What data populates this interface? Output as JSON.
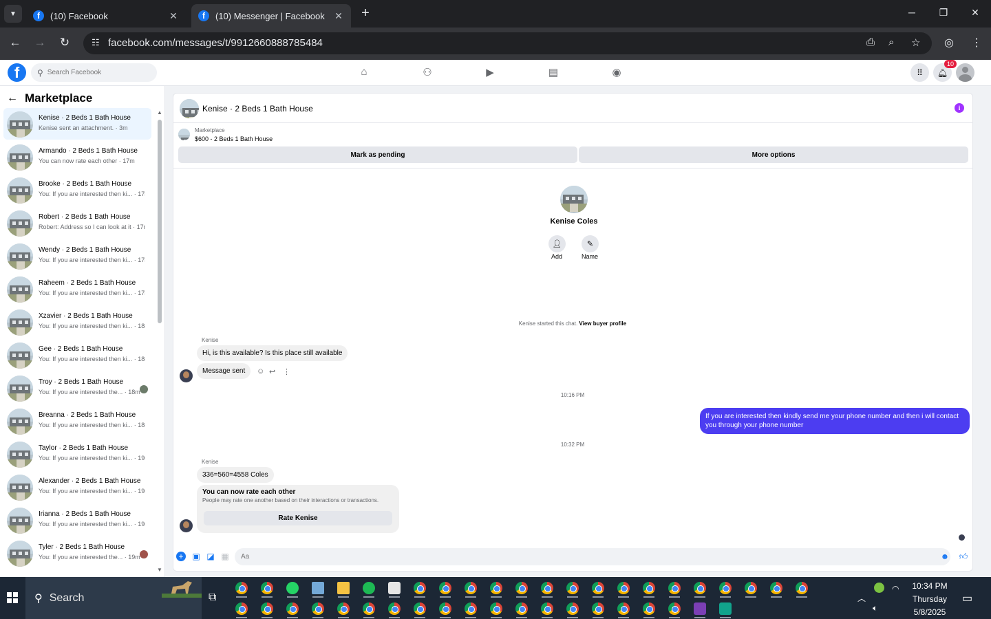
{
  "browser": {
    "tabs": [
      {
        "title": "(10) Facebook",
        "active": false
      },
      {
        "title": "(10) Messenger | Facebook",
        "active": true
      }
    ],
    "url": "facebook.com/messages/t/9912660888785484"
  },
  "fb_header": {
    "search_placeholder": "Search Facebook",
    "notifications_count": "10",
    "nav_icons": [
      "home-icon",
      "friends-icon",
      "watch-icon",
      "marketplace-icon",
      "groups-icon"
    ]
  },
  "sidebar": {
    "title": "Marketplace",
    "conversations": [
      {
        "name": "Kenise · 2 Beds 1 Bath House",
        "preview": "Kenise sent an attachment. · 3m",
        "active": true
      },
      {
        "name": "Armando · 2 Beds 1 Bath House",
        "preview": "You can now rate each other · 17m"
      },
      {
        "name": "Brooke · 2 Beds 1 Bath House",
        "preview": "You: If you are interested then ki... · 17m"
      },
      {
        "name": "Robert · 2 Beds 1 Bath House",
        "preview": "Robert: Address so I can look at it · 17m"
      },
      {
        "name": "Wendy · 2 Beds 1 Bath House",
        "preview": "You: If you are interested then ki... · 17m"
      },
      {
        "name": "Raheem · 2 Beds 1 Bath House",
        "preview": "You: If you are interested then ki... · 17m"
      },
      {
        "name": "Xzavier · 2 Beds 1 Bath House",
        "preview": "You: If you are interested then ki... · 18m"
      },
      {
        "name": "Gee · 2 Beds 1 Bath House",
        "preview": "You: If you are interested then ki... · 18m"
      },
      {
        "name": "Troy · 2 Beds 1 Bath House",
        "preview": "You: If you are interested the... · 18m"
      },
      {
        "name": "Breanna · 2 Beds 1 Bath House",
        "preview": "You: If you are interested then ki... · 18m"
      },
      {
        "name": "Taylor · 2 Beds 1 Bath House",
        "preview": "You: If you are interested then ki... · 19m"
      },
      {
        "name": "Alexander · 2 Beds 1 Bath House",
        "preview": "You: If you are interested then ki... · 19m"
      },
      {
        "name": "Irianna · 2 Beds 1 Bath House",
        "preview": "You: If you are interested then ki... · 19m"
      },
      {
        "name": "Tyler · 2 Beds 1 Bath House",
        "preview": "You: If you are interested the... · 19m"
      }
    ]
  },
  "chat": {
    "header_title": "Kenise · 2 Beds 1 Bath House",
    "marketplace_label": "Marketplace",
    "listing": "$600 - 2 Beds 1 Bath House",
    "mark_pending": "Mark as pending",
    "more_options": "More options",
    "profile_name": "Kenise Coles",
    "add_label": "Add",
    "name_label": "Name",
    "system_text": "Kenise started this chat.",
    "view_buyer": "View buyer profile",
    "sender_1": "Kenise",
    "msg_1": "Hi, is this available? Is this place still available",
    "msg_2": "Message sent",
    "time_1": "10:16 PM",
    "out_msg": "If you are interested then kindly send me your phone number and then i will contact you through your phone number",
    "time_2": "10:32 PM",
    "sender_2": "Kenise",
    "msg_3": "336=560=4558 Coles",
    "rate_title": "You can now rate each other",
    "rate_sub": "People may rate one another based on their interactions or transactions.",
    "rate_btn": "Rate Kenise",
    "composer_placeholder": "Aa"
  },
  "taskbar": {
    "search": "Search",
    "time": "10:34 PM",
    "day": "Thursday",
    "date": "5/8/2025"
  }
}
